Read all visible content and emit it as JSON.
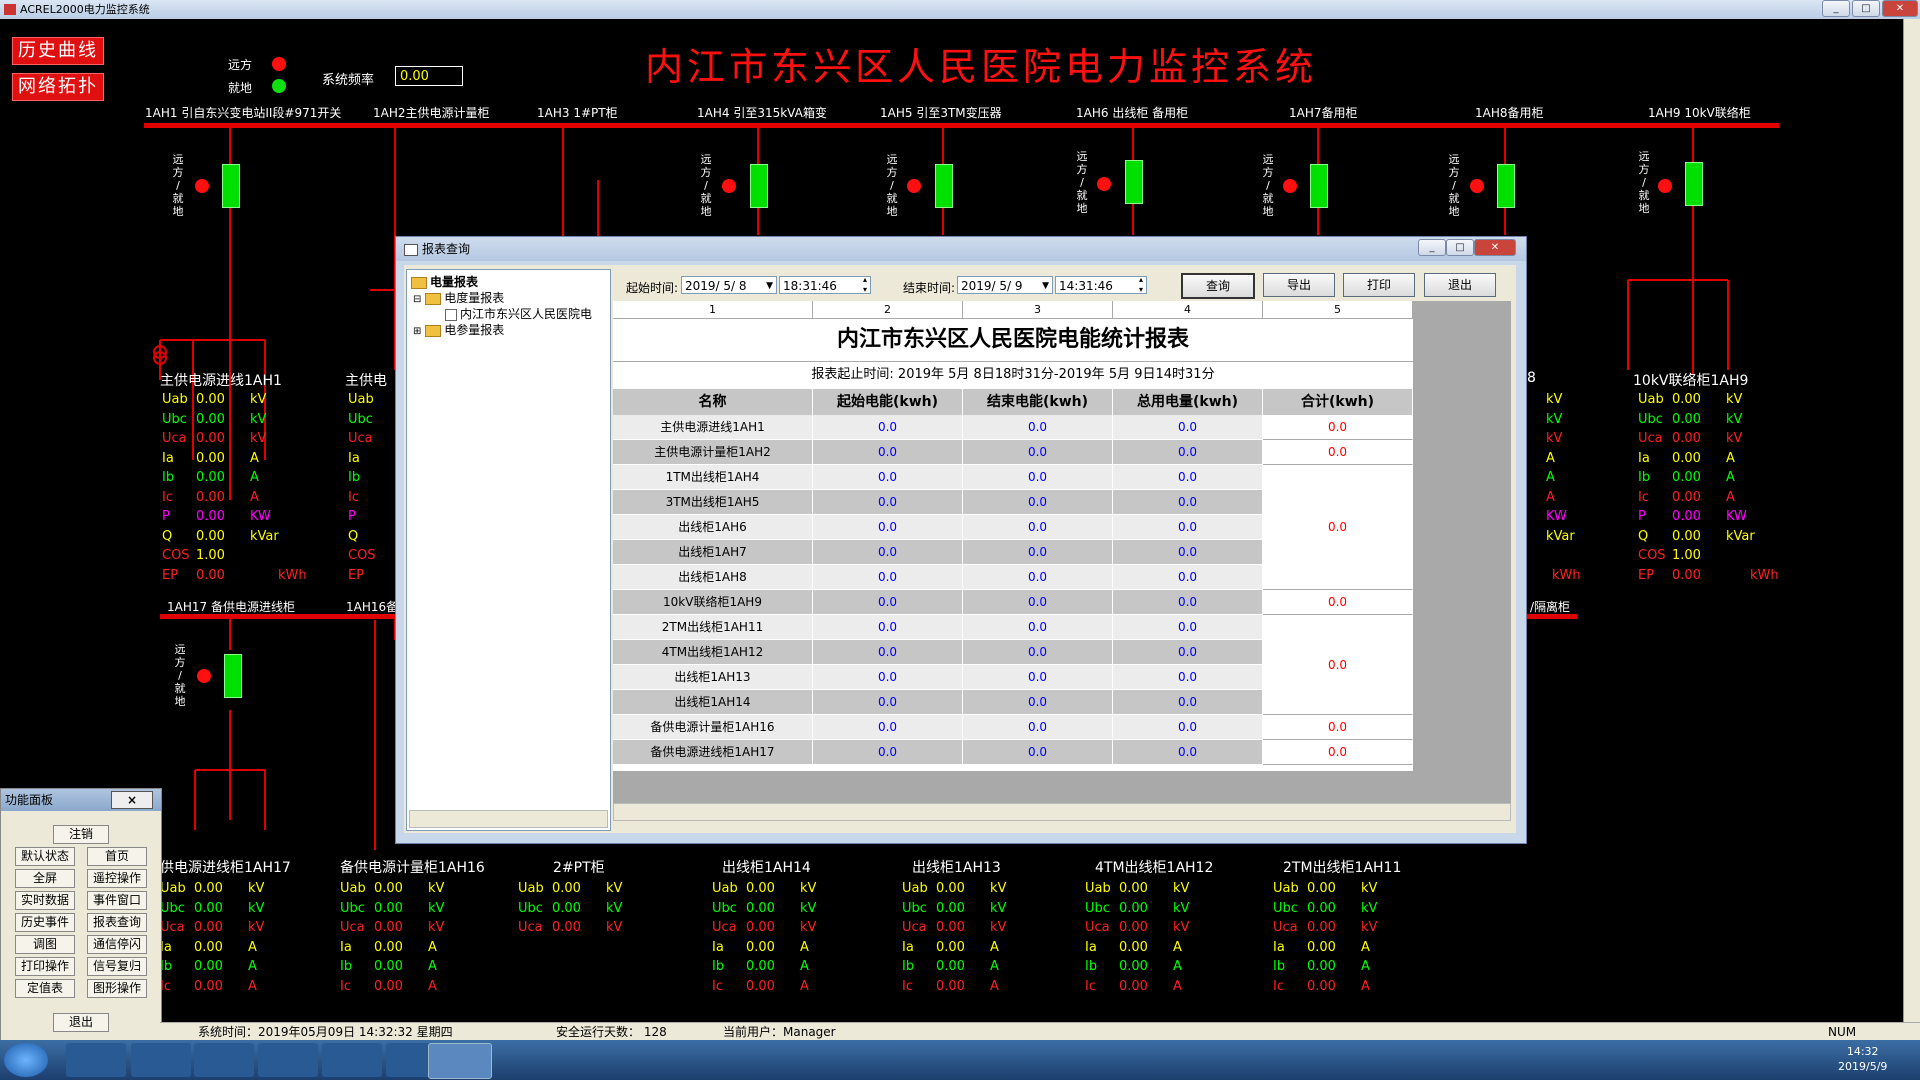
{
  "app": {
    "title": "ACREL2000电力监控系统"
  },
  "header": {
    "btn_history": "历史曲线",
    "btn_topology": "网络拓扑",
    "remote_label": "远方",
    "local_label": "就地",
    "freq_label": "系统频率",
    "freq_value": "0.00",
    "main_title": "内江市东兴区人民医院电力监控系统"
  },
  "switch_label": [
    "远",
    "方",
    "/",
    "就",
    "地"
  ],
  "top_panels": [
    {
      "name": "1AH1 引自东兴变电站II段#971开关"
    },
    {
      "name": "1AH2主供电源计量柜"
    },
    {
      "name": "1AH3 1#PT柜"
    },
    {
      "name": "1AH4 引至315kVA箱变"
    },
    {
      "name": "1AH5 引至3TM变压器"
    },
    {
      "name": "1AH6 出线柜 备用柜"
    },
    {
      "name": "1AH7备用柜"
    },
    {
      "name": "1AH8备用柜"
    },
    {
      "name": "1AH9 10kV联络柜"
    }
  ],
  "meas_left": {
    "title": "主供电源进线1AH1",
    "rows": [
      {
        "k": "Uab",
        "v": "0.00",
        "u": "kV"
      },
      {
        "k": "Ubc",
        "v": "0.00",
        "u": "kV"
      },
      {
        "k": "Uca",
        "v": "0.00",
        "u": "kV"
      },
      {
        "k": "Ia",
        "v": "0.00",
        "u": "A"
      },
      {
        "k": "Ib",
        "v": "0.00",
        "u": "A"
      },
      {
        "k": "Ic",
        "v": "0.00",
        "u": "A"
      },
      {
        "k": "P",
        "v": "0.00",
        "u": "KW"
      },
      {
        "k": "Q",
        "v": "0.00",
        "u": "kVar"
      },
      {
        "k": "COS",
        "v": "1.00",
        "u": ""
      },
      {
        "k": "EP",
        "v": "0.00",
        "u": "kWh"
      }
    ]
  },
  "meas_left2": {
    "title": "主供电",
    "rows": [
      "Uab",
      "Ubc",
      "Uca",
      "Ia",
      "Ib",
      "Ic",
      "P",
      "Q",
      "COS",
      "EP"
    ]
  },
  "meas_right": {
    "title": "10kV联络柜1AH9",
    "rows": [
      {
        "k": "Uab",
        "v": "0.00",
        "u": "kV"
      },
      {
        "k": "Ubc",
        "v": "0.00",
        "u": "kV"
      },
      {
        "k": "Uca",
        "v": "0.00",
        "u": "kV"
      },
      {
        "k": "Ia",
        "v": "0.00",
        "u": "A"
      },
      {
        "k": "Ib",
        "v": "0.00",
        "u": "A"
      },
      {
        "k": "Ic",
        "v": "0.00",
        "u": "A"
      },
      {
        "k": "P",
        "v": "0.00",
        "u": "KW"
      },
      {
        "k": "Q",
        "v": "0.00",
        "u": "kVar"
      },
      {
        "k": "COS",
        "v": "1.00",
        "u": ""
      },
      {
        "k": "EP",
        "v": "0.00",
        "u": "kWh"
      }
    ]
  },
  "meas_right_partial": {
    "title": "8",
    "units": [
      "kV",
      "kV",
      "kV",
      "A",
      "A",
      "A",
      "KW",
      "kVar",
      "",
      "kWh"
    ],
    "bus2_suffix": "/隔离柜"
  },
  "bus2": {
    "left_label": "1AH17 备供电源进线柜",
    "left2_label": "1AH16备"
  },
  "bottom_panels": [
    {
      "title": "供电源进线柜1AH17",
      "rows": [
        {
          "k": "Uab",
          "v": "0.00",
          "u": "kV"
        },
        {
          "k": "Ubc",
          "v": "0.00",
          "u": "kV"
        },
        {
          "k": "Uca",
          "v": "0.00",
          "u": "kV"
        },
        {
          "k": "Ia",
          "v": "0.00",
          "u": "A"
        },
        {
          "k": "Ib",
          "v": "0.00",
          "u": "A"
        },
        {
          "k": "Ic",
          "v": "0.00",
          "u": "A"
        }
      ]
    },
    {
      "title": "备供电源计量柜1AH16",
      "rows": [
        {
          "k": "Uab",
          "v": "0.00",
          "u": "kV"
        },
        {
          "k": "Ubc",
          "v": "0.00",
          "u": "kV"
        },
        {
          "k": "Uca",
          "v": "0.00",
          "u": "kV"
        },
        {
          "k": "Ia",
          "v": "0.00",
          "u": "A"
        },
        {
          "k": "Ib",
          "v": "0.00",
          "u": "A"
        },
        {
          "k": "Ic",
          "v": "0.00",
          "u": "A"
        }
      ]
    },
    {
      "title": "2#PT柜",
      "rows": [
        {
          "k": "Uab",
          "v": "0.00",
          "u": "kV"
        },
        {
          "k": "Ubc",
          "v": "0.00",
          "u": "kV"
        },
        {
          "k": "Uca",
          "v": "0.00",
          "u": "kV"
        }
      ]
    },
    {
      "title": "出线柜1AH14",
      "rows": [
        {
          "k": "Uab",
          "v": "0.00",
          "u": "kV"
        },
        {
          "k": "Ubc",
          "v": "0.00",
          "u": "kV"
        },
        {
          "k": "Uca",
          "v": "0.00",
          "u": "kV"
        },
        {
          "k": "Ia",
          "v": "0.00",
          "u": "A"
        },
        {
          "k": "Ib",
          "v": "0.00",
          "u": "A"
        },
        {
          "k": "Ic",
          "v": "0.00",
          "u": "A"
        }
      ]
    },
    {
      "title": "出线柜1AH13",
      "rows": [
        {
          "k": "Uab",
          "v": "0.00",
          "u": "kV"
        },
        {
          "k": "Ubc",
          "v": "0.00",
          "u": "kV"
        },
        {
          "k": "Uca",
          "v": "0.00",
          "u": "kV"
        },
        {
          "k": "Ia",
          "v": "0.00",
          "u": "A"
        },
        {
          "k": "Ib",
          "v": "0.00",
          "u": "A"
        },
        {
          "k": "Ic",
          "v": "0.00",
          "u": "A"
        }
      ]
    },
    {
      "title": "4TM出线柜1AH12",
      "rows": [
        {
          "k": "Uab",
          "v": "0.00",
          "u": "kV"
        },
        {
          "k": "Ubc",
          "v": "0.00",
          "u": "kV"
        },
        {
          "k": "Uca",
          "v": "0.00",
          "u": "kV"
        },
        {
          "k": "Ia",
          "v": "0.00",
          "u": "A"
        },
        {
          "k": "Ib",
          "v": "0.00",
          "u": "A"
        },
        {
          "k": "Ic",
          "v": "0.00",
          "u": "A"
        }
      ]
    },
    {
      "title": "2TM出线柜1AH11",
      "rows": [
        {
          "k": "Uab",
          "v": "0.00",
          "u": "kV"
        },
        {
          "k": "Ubc",
          "v": "0.00",
          "u": "kV"
        },
        {
          "k": "Uca",
          "v": "0.00",
          "u": "kV"
        },
        {
          "k": "Ia",
          "v": "0.00",
          "u": "A"
        },
        {
          "k": "Ib",
          "v": "0.00",
          "u": "A"
        },
        {
          "k": "Ic",
          "v": "0.00",
          "u": "A"
        }
      ]
    }
  ],
  "function_panel": {
    "title": "功能面板",
    "close": "×",
    "buttons": [
      "注销",
      "默认状态",
      "首页",
      "全屏",
      "遥控操作",
      "实时数据",
      "事件窗口",
      "历史事件",
      "报表查询",
      "调图",
      "通信停闪",
      "打印操作",
      "信号复归",
      "定值表",
      "图形操作",
      "退出"
    ]
  },
  "dialog": {
    "title": "报表查询",
    "tree": {
      "root": "电量报表",
      "child1": "电度量报表",
      "leaf": "内江市东兴区人民医院电",
      "child2": "电参量报表"
    },
    "start_label": "起始时间:",
    "start_date": "2019/ 5/ 8",
    "start_time": "18:31:46",
    "end_label": "结束时间:",
    "end_date": "2019/ 5/ 9",
    "end_time": "14:31:46",
    "btn_query": "查询",
    "btn_export": "导出",
    "btn_print": "打印",
    "btn_exit": "退出"
  },
  "report": {
    "col_numbers": [
      "1",
      "2",
      "3",
      "4",
      "5"
    ],
    "title": "内江市东兴区人民医院电能统计报表",
    "subtitle": "报表起止时间: 2019年 5月 8日18时31分-2019年 5月 9日14时31分",
    "headers": [
      "名称",
      "起始电能(kwh)",
      "结束电能(kwh)",
      "总用电量(kwh)",
      "合计(kwh)"
    ],
    "rows": [
      {
        "name": "主供电源进线1AH1",
        "start": "0.0",
        "end": "0.0",
        "total": "0.0"
      },
      {
        "name": "主供电源计量柜1AH2",
        "start": "0.0",
        "end": "0.0",
        "total": "0.0"
      },
      {
        "name": "1TM出线柜1AH4",
        "start": "0.0",
        "end": "0.0",
        "total": "0.0"
      },
      {
        "name": "3TM出线柜1AH5",
        "start": "0.0",
        "end": "0.0",
        "total": "0.0"
      },
      {
        "name": "出线柜1AH6",
        "start": "0.0",
        "end": "0.0",
        "total": "0.0"
      },
      {
        "name": "出线柜1AH7",
        "start": "0.0",
        "end": "0.0",
        "total": "0.0"
      },
      {
        "name": "出线柜1AH8",
        "start": "0.0",
        "end": "0.0",
        "total": "0.0"
      },
      {
        "name": "10kV联络柜1AH9",
        "start": "0.0",
        "end": "0.0",
        "total": "0.0"
      },
      {
        "name": "2TM出线柜1AH11",
        "start": "0.0",
        "end": "0.0",
        "total": "0.0"
      },
      {
        "name": "4TM出线柜1AH12",
        "start": "0.0",
        "end": "0.0",
        "total": "0.0"
      },
      {
        "name": "出线柜1AH13",
        "start": "0.0",
        "end": "0.0",
        "total": "0.0"
      },
      {
        "name": "出线柜1AH14",
        "start": "0.0",
        "end": "0.0",
        "total": "0.0"
      },
      {
        "name": "备供电源计量柜1AH16",
        "start": "0.0",
        "end": "0.0",
        "total": "0.0"
      },
      {
        "name": "备供电源进线柜1AH17",
        "start": "0.0",
        "end": "0.0",
        "total": "0.0"
      }
    ],
    "sums": [
      "0.0",
      "0.0",
      "0.0",
      "0.0",
      "0.0",
      "0.0",
      "0.0"
    ]
  },
  "statusbar": {
    "system_time": "系统时间：2019年05月09日  14:32:32  星期四",
    "safe_days": "安全运行天数：  128",
    "current_user": "当前用户：Manager",
    "num": "NUM"
  },
  "taskbar": {
    "time": "14:32",
    "date": "2019/5/9"
  },
  "colors": {
    "accent_red": "#e00000",
    "breaker_green": "#00e000",
    "value_yellow": "#ffff00",
    "value_blue": "#0000ff"
  }
}
